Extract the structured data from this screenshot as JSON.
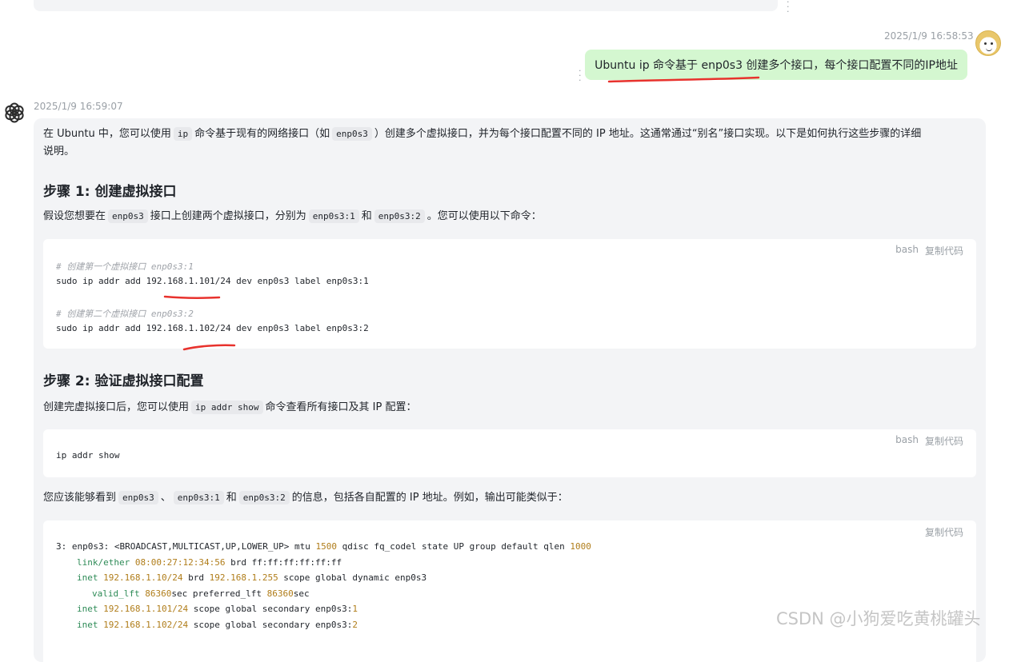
{
  "user_message": {
    "timestamp": "2025/1/9 16:58:53",
    "text": "Ubuntu ip 命令基于 enp0s3 创建多个接口，每个接口配置不同的IP地址"
  },
  "assistant_message": {
    "timestamp": "2025/1/9 16:59:07",
    "intro": {
      "p1": "在 Ubuntu 中，您可以使用",
      "c1": "ip",
      "p2": "命令基于现有的网络接口（如",
      "c2": "enp0s3",
      "p3": "）创建多个虚拟接口，并为每个接口配置不同的 IP 地址。这通常通过“别名”接口实现。以下是如何执行这些步骤的详细",
      "p4": "说明。"
    },
    "step1": {
      "heading": "步骤 1: 创建虚拟接口",
      "text_a": "假设您想要在",
      "code_a": "enp0s3",
      "text_b": "接口上创建两个虚拟接口，分别为",
      "code_b": "enp0s3:1",
      "text_c": "和",
      "code_c": "enp0s3:2",
      "text_d": "。您可以使用以下命令："
    },
    "code1": {
      "lang": "bash",
      "copy": "复制代码",
      "comment1": "# 创建第一个虚拟接口 enp0s3:1",
      "cmd1": "sudo ip addr add 192.168.1.101/24 dev enp0s3 label enp0s3:1",
      "comment2": "# 创建第二个虚拟接口 enp0s3:2",
      "cmd2": "sudo ip addr add 192.168.1.102/24 dev enp0s3 label enp0s3:2"
    },
    "step2": {
      "heading": "步骤 2: 验证虚拟接口配置",
      "text_a": "创建完虚拟接口后，您可以使用",
      "code_a": "ip addr show",
      "text_b": "命令查看所有接口及其 IP 配置："
    },
    "code2": {
      "lang": "bash",
      "copy": "复制代码",
      "cmd": "ip addr show"
    },
    "output_intro": {
      "text_a": "您应该能够看到",
      "code_a": "enp0s3",
      "sep": "、",
      "code_b": "enp0s3:1",
      "text_b": "和",
      "code_c": "enp0s3:2",
      "text_c": "的信息，包括各自配置的 IP 地址。例如，输出可能类似于："
    },
    "code3": {
      "copy": "复制代码",
      "l1_a": "3: enp0s3: <BROADCAST,MULTICAST,UP,LOWER_UP> mtu ",
      "l1_n1": "1500",
      "l1_b": " qdisc fq_codel state UP group default qlen ",
      "l1_n2": "1000",
      "l2_k": "link/ether",
      "l2_n": "08:00:27:12:34:56",
      "l2_b": " brd ff:ff:ff:ff:ff:ff",
      "l3_k": "inet",
      "l3_n": "192.168.1.10/24",
      "l3_b": " brd ",
      "l3_n2": "192.168.1.255",
      "l3_c": " scope global dynamic enp0s3",
      "l4_k": "valid_lft",
      "l4_n": "86360",
      "l4_b": "sec preferred_lft ",
      "l4_n2": "86360",
      "l4_c": "sec",
      "l5_k": "inet",
      "l5_n": "192.168.1.101/24",
      "l5_b": " scope global secondary enp0s3:",
      "l5_n2": "1",
      "l6_k": "inet",
      "l6_n": "192.168.1.102/24",
      "l6_b": " scope global secondary enp0s3:",
      "l6_n2": "2"
    }
  },
  "watermark": "CSDN @小狗爱吃黄桃罐头",
  "colors": {
    "user_bubble": "#d4f7d0",
    "answer_bg": "#f3f4f6",
    "annotation_red": "#e8322d"
  },
  "icons": {
    "assistant": "openai-logo-icon",
    "user": "user-avatar-icon",
    "more": "vertical-dots-icon"
  }
}
